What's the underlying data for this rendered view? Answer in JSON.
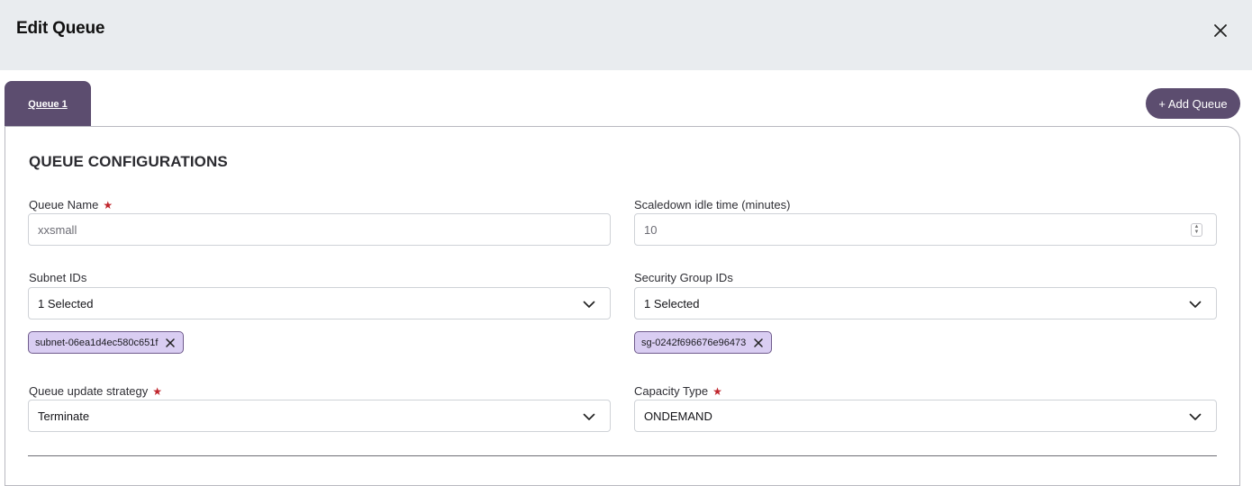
{
  "header": {
    "title": "Edit Queue"
  },
  "tabs": [
    {
      "label": "Queue 1",
      "active": true
    }
  ],
  "actions": {
    "add_queue_label": "+ Add Queue"
  },
  "section": {
    "title": "QUEUE CONFIGURATIONS"
  },
  "form": {
    "queue_name": {
      "label": "Queue Name",
      "required": true,
      "value": "xxsmall"
    },
    "scaledown_idle_time": {
      "label": "Scaledown idle time (minutes)",
      "value": "10"
    },
    "subnet_ids": {
      "label": "Subnet IDs",
      "value": "1 Selected",
      "chips": [
        "subnet-06ea1d4ec580c651f"
      ]
    },
    "security_group_ids": {
      "label": "Security Group IDs",
      "value": "1 Selected",
      "chips": [
        "sg-0242f696676e96473"
      ]
    },
    "queue_update_strategy": {
      "label": "Queue update strategy",
      "required": true,
      "value": "Terminate"
    },
    "capacity_type": {
      "label": "Capacity Type",
      "required": true,
      "value": "ONDEMAND"
    }
  },
  "colors": {
    "accent": "#5c4d6f",
    "chip_bg": "#d9cdf2",
    "header_bg": "#e9ecef",
    "required": "#c0262d"
  },
  "icons": {
    "close": "close-icon",
    "chevron": "chevron-down-icon",
    "remove_chip": "close-icon"
  }
}
